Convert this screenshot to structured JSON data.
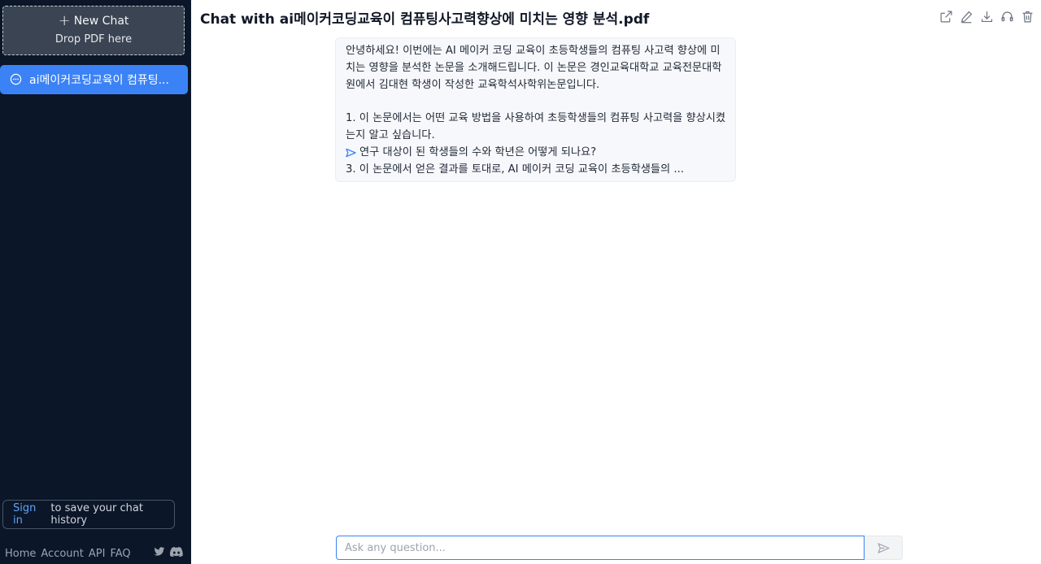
{
  "sidebar": {
    "new_chat_label": "New Chat",
    "new_chat_plus": "+",
    "drop_label": "Drop PDF here",
    "chats": [
      {
        "label": "ai메이커코딩교육이 컴퓨팅...",
        "icon": "chat-bubble-icon"
      }
    ],
    "signin_link": "Sign in",
    "signin_text": "to save your chat history",
    "footer_links": [
      "Home",
      "Account",
      "API",
      "FAQ"
    ],
    "social_icons": [
      "twitter-icon",
      "discord-icon"
    ]
  },
  "header": {
    "title": "Chat with ai메이커코딩교육이 컴퓨팅사고력향상에 미치는 영향 분석.pdf",
    "toolbar_icons": [
      "share-icon",
      "edit-icon",
      "download-icon",
      "headset-icon",
      "trash-icon"
    ]
  },
  "message": {
    "intro": "안녕하세요! 이번에는 AI 메이커 코딩 교육이 초등학생들의 컴퓨팅 사고력 향상에 미치는 영향을 분석한 논문을 소개해드립니다. 이 논문은 경인교육대학교 교육전문대학원에서 김대현 학생이 작성한 교육학석사학위논문입니다.",
    "q1": "1. 이 논문에서는 어떤 교육 방법을 사용하여 초등학생들의 컴퓨팅 사고력을 향상시켰는지 알고 싶습니다.",
    "q2": "연구 대상이 된 학생들의 수와 학년은 어떻게 되나요?",
    "q3": "3. 이 논문에서 얻은 결과를 토대로, AI 메이커 코딩 교육이 초등학생들의 ..."
  },
  "input": {
    "placeholder": "Ask any question...",
    "value": ""
  },
  "colors": {
    "sidebar_bg": "#0b1629",
    "accent": "#3b82f6",
    "link": "#60a5fa"
  }
}
